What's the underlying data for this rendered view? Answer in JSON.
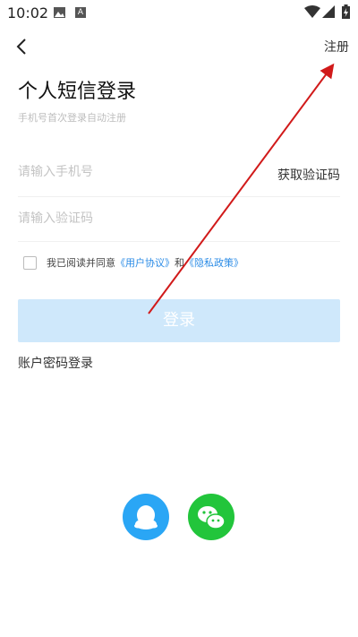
{
  "status_bar": {
    "time": "10:02",
    "a_badge": "A"
  },
  "header": {
    "register_label": "注册"
  },
  "title": "个人短信登录",
  "subtitle": "手机号首次登录自动注册",
  "phone_field": {
    "placeholder": "请输入手机号",
    "get_code_label": "获取验证码"
  },
  "code_field": {
    "placeholder": "请输入验证码"
  },
  "agreement": {
    "prefix": "我已阅读并同意",
    "user_agreement": "《用户协议》",
    "and": "和",
    "privacy_policy": "《隐私政策》"
  },
  "login_button": {
    "label": "登录"
  },
  "password_login": {
    "label": "账户密码登录"
  },
  "social": {
    "qq_icon": "qq-icon",
    "wechat_icon": "wechat-icon"
  },
  "colors": {
    "link": "#2a8be6",
    "login_button_bg": "#cfe8fb",
    "qq": "#2aa6f5",
    "wechat": "#22c53b",
    "annotation": "#d11a1a"
  }
}
